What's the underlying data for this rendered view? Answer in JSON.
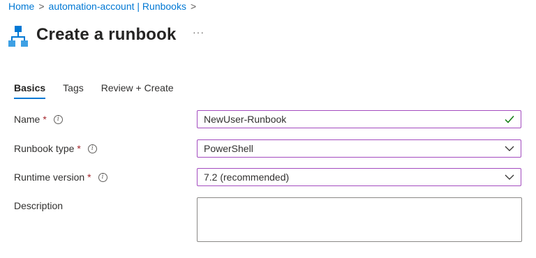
{
  "breadcrumb": {
    "items": [
      "Home",
      "automation-account | Runbooks"
    ],
    "separator": ">"
  },
  "header": {
    "title": "Create a runbook",
    "more_label": "···",
    "icon": "runbook-hierarchy-icon"
  },
  "tabs": [
    {
      "label": "Basics",
      "active": true
    },
    {
      "label": "Tags",
      "active": false
    },
    {
      "label": "Review + Create",
      "active": false
    }
  ],
  "form": {
    "name": {
      "label": "Name",
      "required_mark": "*",
      "value": "NewUser-Runbook",
      "valid_icon": "checkmark-icon"
    },
    "runbook_type": {
      "label": "Runbook type",
      "required_mark": "*",
      "value": "PowerShell"
    },
    "runtime_version": {
      "label": "Runtime version",
      "required_mark": "*",
      "value": "7.2 (recommended)"
    },
    "description": {
      "label": "Description",
      "value": ""
    }
  },
  "colors": {
    "accent": "#0078d4",
    "required": "#a4262c",
    "valid": "#107c10",
    "field_border": "#a34bbf"
  }
}
